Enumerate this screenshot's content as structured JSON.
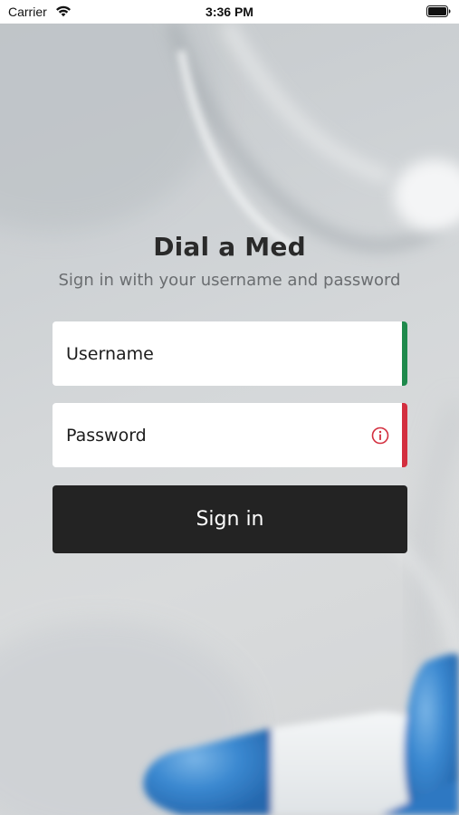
{
  "status_bar": {
    "carrier": "Carrier",
    "time": "3:36 PM",
    "wifi_icon": "wifi-icon",
    "battery_icon": "battery-icon"
  },
  "login": {
    "title": "Dial a Med",
    "subtitle": "Sign in with your username and password",
    "username": {
      "placeholder": "Username",
      "value": "",
      "status_color": "#1f8a4c"
    },
    "password": {
      "placeholder": "Password",
      "value": "",
      "status_color": "#d32f3f",
      "status_icon": "info-icon"
    },
    "signin_label": "Sign in"
  },
  "colors": {
    "button_background": "#232323",
    "button_text": "#ffffff",
    "valid": "#1f8a4c",
    "error": "#d32f3f"
  }
}
